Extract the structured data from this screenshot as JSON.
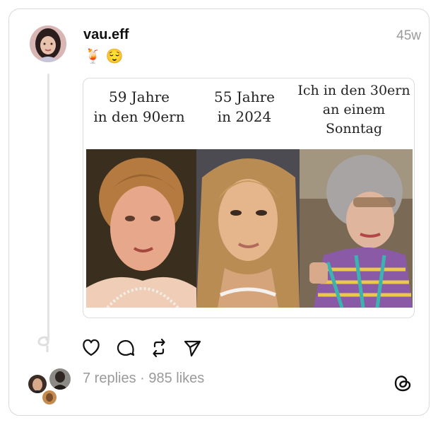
{
  "post": {
    "username": "vau.eff",
    "timestamp": "45w",
    "caption": "🍹 😌"
  },
  "media": {
    "labels": [
      "59 Jahre\nin den 90ern",
      "55 Jahre\nin 2024",
      "Ich in den 30ern\nan einem\nSonntag"
    ]
  },
  "actions": {
    "like_icon": "heart-icon",
    "reply_icon": "comment-icon",
    "repost_icon": "repost-icon",
    "share_icon": "send-icon"
  },
  "footer": {
    "stats": "7 replies · 985 likes",
    "logo_icon": "threads-logo-icon"
  },
  "colors": {
    "text": "#111111",
    "muted": "#9a9a9a",
    "border": "#d9d9d9"
  }
}
